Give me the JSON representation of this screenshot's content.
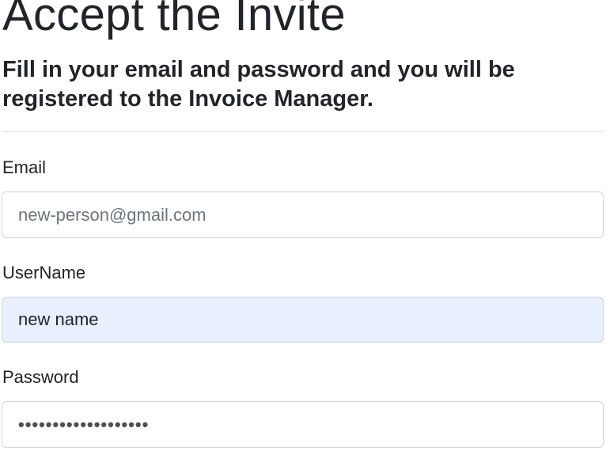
{
  "heading": "Accept the Invite",
  "subheading": "Fill in your email and password and you will be registered to the Invoice Manager.",
  "fields": {
    "email": {
      "label": "Email",
      "value": "",
      "placeholder": "new-person@gmail.com"
    },
    "username": {
      "label": "UserName",
      "value": "new name"
    },
    "password": {
      "label": "Password",
      "masked_value": "•••••••••••••••••••"
    }
  },
  "colors": {
    "autofill_background": "#e8f0fe",
    "input_border": "#ced4da",
    "divider": "#dee2e6"
  }
}
